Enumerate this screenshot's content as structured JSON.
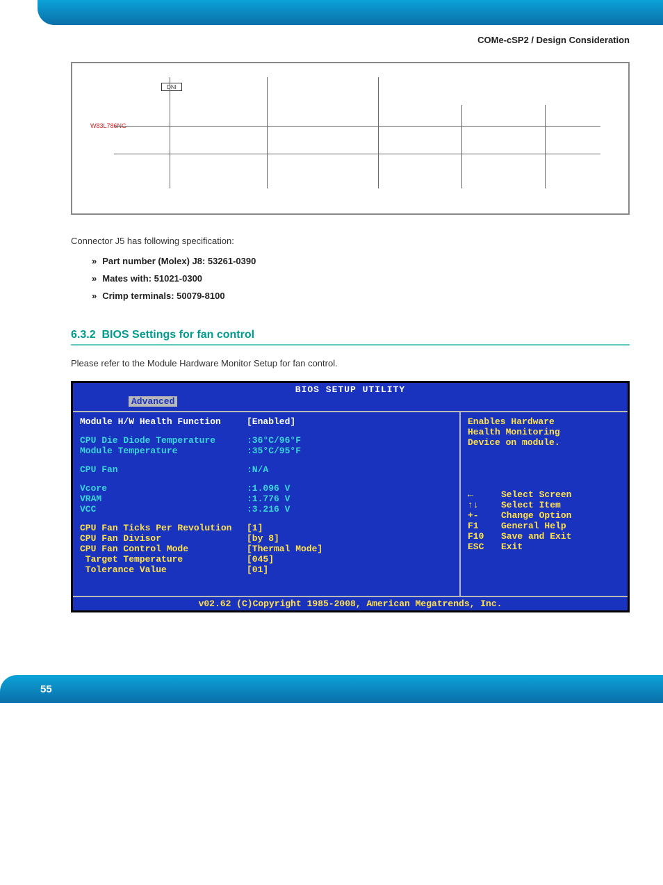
{
  "header": {
    "breadcrumb": "COMe-cSP2 / Design Consideration"
  },
  "schematic": {
    "dni": "DNI",
    "chip": "W83L786NG"
  },
  "spec": {
    "intro": "Connector J5 has following specification:",
    "items": [
      "Part number (Molex) J8: 53261-0390",
      "Mates with: 51021-0300",
      "Crimp terminals: 50079-8100"
    ]
  },
  "section": {
    "number": "6.3.2",
    "title": "BIOS Settings for fan control",
    "refer": "Please refer to the Module Hardware Monitor Setup for fan control."
  },
  "bios": {
    "title": "BIOS SETUP UTILITY",
    "tab": "Advanced",
    "left": {
      "hw_label": "Module H/W Health Function",
      "hw_value": "[Enabled]",
      "cpu_die_label": "CPU Die Diode Temperature",
      "cpu_die_value": ":36°C/96°F",
      "mod_temp_label": "Module Temperature",
      "mod_temp_value": ":35°C/95°F",
      "cpu_fan_label": "CPU Fan",
      "cpu_fan_value": ":N/A",
      "vcore_label": "Vcore",
      "vcore_value": ":1.096 V",
      "vram_label": "VRAM",
      "vram_value": ":1.776 V",
      "vcc_label": "VCC",
      "vcc_value": ":3.216 V",
      "ticks_label": "CPU Fan Ticks Per Revolution",
      "ticks_value": "[1]",
      "div_label": "CPU Fan Divisor",
      "div_value": "[by 8]",
      "mode_label": "CPU Fan Control Mode",
      "mode_value": "[Thermal Mode]",
      "tgt_label": " Target Temperature",
      "tgt_value": "[045]",
      "tol_label": " Tolerance Value",
      "tol_value": "[01]"
    },
    "right": {
      "help1": "Enables Hardware",
      "help2": "Health Monitoring",
      "help3": "Device on module.",
      "keys": [
        {
          "k": "←",
          "d": "Select Screen"
        },
        {
          "k": "↑↓",
          "d": "Select Item"
        },
        {
          "k": "+-",
          "d": "Change Option"
        },
        {
          "k": "F1",
          "d": "General Help"
        },
        {
          "k": "F10",
          "d": "Save and Exit"
        },
        {
          "k": "ESC",
          "d": "Exit"
        }
      ]
    },
    "footer": "v02.62 (C)Copyright 1985-2008, American Megatrends, Inc."
  },
  "page_number": "55"
}
